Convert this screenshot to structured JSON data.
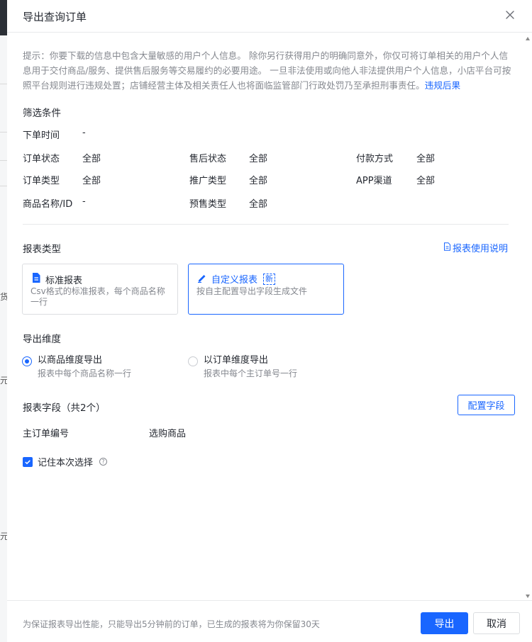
{
  "drawer": {
    "title": "导出查询订单"
  },
  "notice": {
    "text": "提示：你要下载的信息中包含大量敏感的用户个人信息。 除你另行获得用户的明确同意外，你仅可将订单相关的用户个人信息用于交付商品/服务、提供售后服务等交易履约的必要用途。 一旦非法使用或向他人非法提供用户个人信息，小店平台可按照平台规则进行违规处置；店铺经营主体及相关责任人也将面临监管部门行政处罚乃至承担刑事责任。",
    "link": "违规后果"
  },
  "filters": {
    "title": "筛选条件",
    "order_time_label": "下单时间",
    "order_time_value": "-",
    "items": [
      {
        "label": "订单状态",
        "value": "全部"
      },
      {
        "label": "售后状态",
        "value": "全部"
      },
      {
        "label": "付款方式",
        "value": "全部"
      },
      {
        "label": "订单类型",
        "value": "全部"
      },
      {
        "label": "推广类型",
        "value": "全部"
      },
      {
        "label": "APP渠道",
        "value": "全部"
      },
      {
        "label": "商品名称/ID",
        "value": "-"
      },
      {
        "label": "预售类型",
        "value": "全部"
      }
    ]
  },
  "report_type": {
    "title": "报表类型",
    "help_link": "报表使用说明",
    "cards": [
      {
        "title": "标准报表",
        "desc": "Csv格式的标准报表，每个商品名称一行",
        "badge": ""
      },
      {
        "title": "自定义报表",
        "desc": "按自主配置导出字段生成文件",
        "badge": "新"
      }
    ]
  },
  "dimension": {
    "title": "导出维度",
    "options": [
      {
        "label": "以商品维度导出",
        "sub": "报表中每个商品名称一行"
      },
      {
        "label": "以订单维度导出",
        "sub": "报表中每个主订单号一行"
      }
    ]
  },
  "fields": {
    "title": "报表字段（共2个）",
    "config_button": "配置字段",
    "items": [
      "主订单编号",
      "选购商品"
    ]
  },
  "remember": {
    "label": "记住本次选择"
  },
  "footer": {
    "note": "为保证报表导出性能，只能导出5分钟前的订单，已生成的报表将为你保留30天",
    "export_button": "导出",
    "cancel_button": "取消"
  },
  "colors": {
    "accent": "#1966ff",
    "text": "#252931",
    "muted": "#85888f"
  },
  "background_app": {
    "glyphs": [
      "货",
      "元",
      "元"
    ]
  }
}
